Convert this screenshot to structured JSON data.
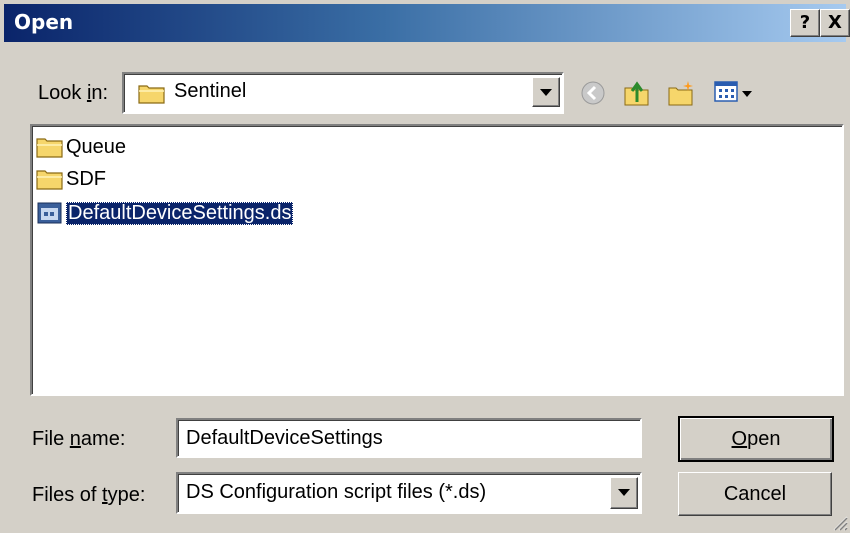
{
  "title": "Open",
  "titlebar": {
    "help_label": "?",
    "close_label": "X"
  },
  "look_in": {
    "label_pre": "Look ",
    "label_key": "i",
    "label_post": "n:",
    "value": "Sentinel",
    "icon": "folder-icon"
  },
  "toolbar": {
    "icons": [
      "back-icon",
      "up-folder-icon",
      "new-folder-icon",
      "view-menu-icon"
    ]
  },
  "files": [
    {
      "name": "Queue",
      "icon": "folder-icon",
      "selected": false
    },
    {
      "name": "SDF",
      "icon": "folder-icon",
      "selected": false
    },
    {
      "name": "DefaultDeviceSettings.ds",
      "icon": "ds-file-icon",
      "selected": true
    }
  ],
  "file_name": {
    "label_pre": "File ",
    "label_key": "n",
    "label_post": "ame:",
    "value": "DefaultDeviceSettings"
  },
  "file_type": {
    "label_pre": "Files of ",
    "label_key": "t",
    "label_post": "ype:",
    "value": "DS Configuration script files (*.ds)"
  },
  "buttons": {
    "open_key": "O",
    "open_rest": "pen",
    "cancel": "Cancel"
  },
  "colors": {
    "titlebar_start": "#0a246a",
    "titlebar_end": "#a6caf0",
    "face": "#d4d0c8",
    "selection": "#0a246a"
  }
}
